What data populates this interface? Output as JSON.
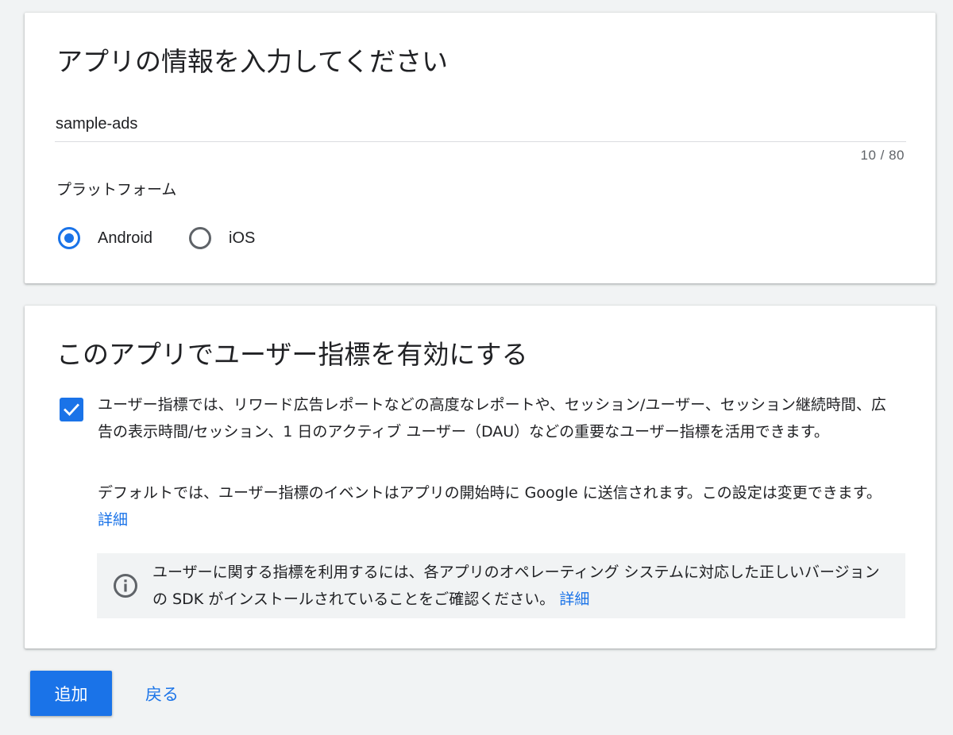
{
  "app_info": {
    "title": "アプリの情報を入力してください",
    "app_name_value": "sample-ads",
    "char_counter": "10 / 80",
    "platform_label": "プラットフォーム",
    "platform_options": [
      {
        "label": "Android",
        "selected": true
      },
      {
        "label": "iOS",
        "selected": false
      }
    ]
  },
  "user_metrics": {
    "title": "このアプリでユーザー指標を有効にする",
    "checkbox_checked": true,
    "paragraph1": "ユーザー指標では、リワード広告レポートなどの高度なレポートや、セッション/ユーザー、セッション継続時間、広告の表示時間/セッション、1 日のアクティブ ユーザー（DAU）などの重要なユーザー指標を活用できます。",
    "paragraph2": "デフォルトでは、ユーザー指標のイベントはアプリの開始時に Google に送信されます。この設定は変更できます。",
    "paragraph2_link": "詳細",
    "info_text": "ユーザーに関する指標を利用するには、各アプリのオペレーティング システムに対応した正しいバージョンの SDK がインストールされていることをご確認ください。",
    "info_link": "詳細",
    "info_icon": "info-icon"
  },
  "actions": {
    "add_label": "追加",
    "back_label": "戻る"
  },
  "colors": {
    "accent": "#1a73e8",
    "background": "#f1f3f4",
    "card": "#ffffff"
  }
}
